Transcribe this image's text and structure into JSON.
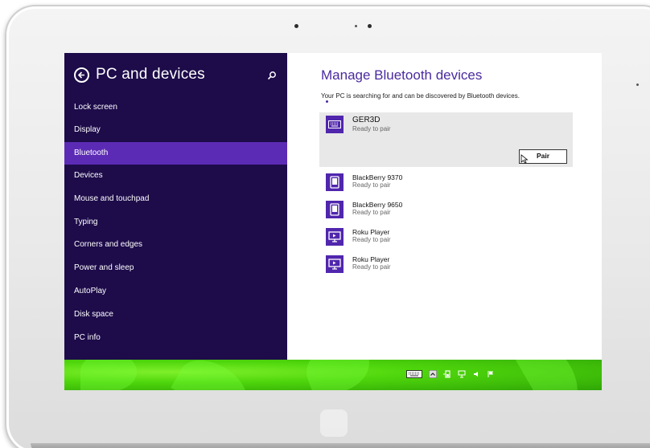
{
  "sidebar": {
    "title": "PC and devices",
    "items": [
      {
        "label": "Lock screen",
        "active": false
      },
      {
        "label": "Display",
        "active": false
      },
      {
        "label": "Bluetooth",
        "active": true
      },
      {
        "label": "Devices",
        "active": false
      },
      {
        "label": "Mouse and touchpad",
        "active": false
      },
      {
        "label": "Typing",
        "active": false
      },
      {
        "label": "Corners and edges",
        "active": false
      },
      {
        "label": "Power and sleep",
        "active": false
      },
      {
        "label": "AutoPlay",
        "active": false
      },
      {
        "label": "Disk space",
        "active": false
      },
      {
        "label": "PC info",
        "active": false
      }
    ]
  },
  "main": {
    "title": "Manage Bluetooth devices",
    "subtitle": "Your PC is searching for and can be discovered by Bluetooth devices.",
    "devices": [
      {
        "name": "GER3D",
        "status": "Ready to pair",
        "icon": "keyboard-icon",
        "selected": true
      },
      {
        "name": "BlackBerry 9370",
        "status": "Ready to pair",
        "icon": "phone-icon",
        "selected": false
      },
      {
        "name": "BlackBerry 9650",
        "status": "Ready to pair",
        "icon": "phone-icon",
        "selected": false
      },
      {
        "name": "Roku Player",
        "status": "Ready to pair",
        "icon": "media-player-icon",
        "selected": false
      },
      {
        "name": "Roku Player",
        "status": "Ready to pair",
        "icon": "media-player-icon",
        "selected": false
      }
    ],
    "pair_label": "Pair"
  },
  "colors": {
    "sidebar_bg": "#1d0b4a",
    "accent": "#5c2bb5",
    "title": "#4a2aa0",
    "desktop": "#4fd60c"
  },
  "tray_icons": [
    "keyboard-icon",
    "show-hidden-icons-icon",
    "battery-icon",
    "network-icon",
    "volume-icon",
    "flag-icon"
  ]
}
